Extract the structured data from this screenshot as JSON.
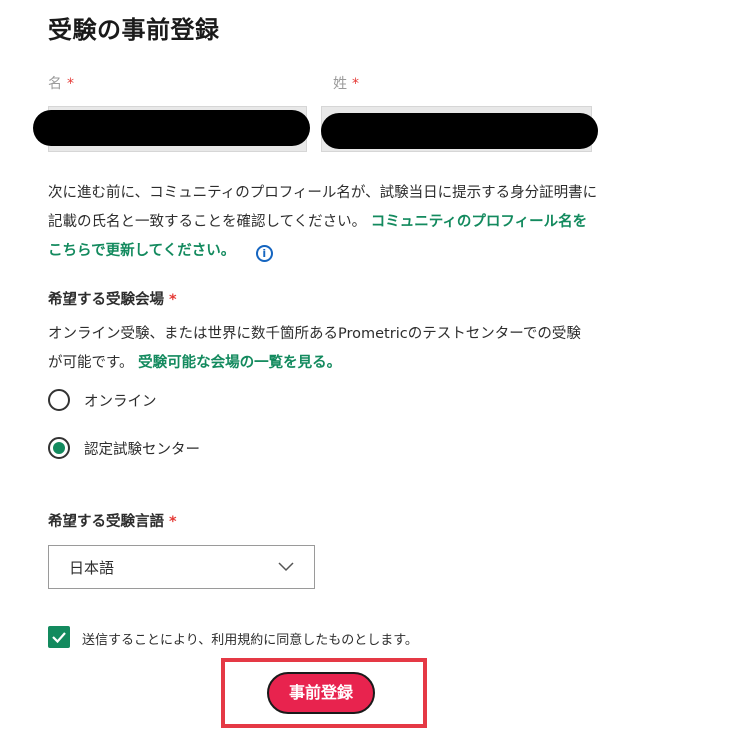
{
  "page": {
    "title": "受験の事前登録"
  },
  "form": {
    "first_name_label": "名",
    "last_name_label": "姓",
    "required_mark": "*",
    "notice_text": "次に進む前に、コミュニティのプロフィール名が、試験当日に提示する身分証明書に記載の氏名と一致することを確認してください。",
    "notice_link": "コミュニティのプロフィール名をこちらで更新してください。",
    "info_icon_char": "i",
    "location_label": "希望する受験会場",
    "location_desc": "オンライン受験、または世界に数千箇所あるPrometricのテストセンターでの受験が可能です。",
    "location_link": "受験可能な会場の一覧を見る。",
    "location_options": [
      {
        "label": "オンライン",
        "selected": false
      },
      {
        "label": "認定試験センター",
        "selected": true
      }
    ],
    "language_label": "希望する受験言語",
    "language_value": "日本語",
    "consent_text": "送信することにより、利用規約に同意したものとします。",
    "consent_checked": true,
    "submit_label": "事前登録"
  },
  "colors": {
    "accent": "#138a5e",
    "required": "#e53935",
    "button": "#e8234e",
    "highlight": "#e53945",
    "info": "#1565c0"
  },
  "icons": {
    "chevron": "chevron-down-icon",
    "check": "checkmark-icon",
    "info": "info-icon"
  }
}
